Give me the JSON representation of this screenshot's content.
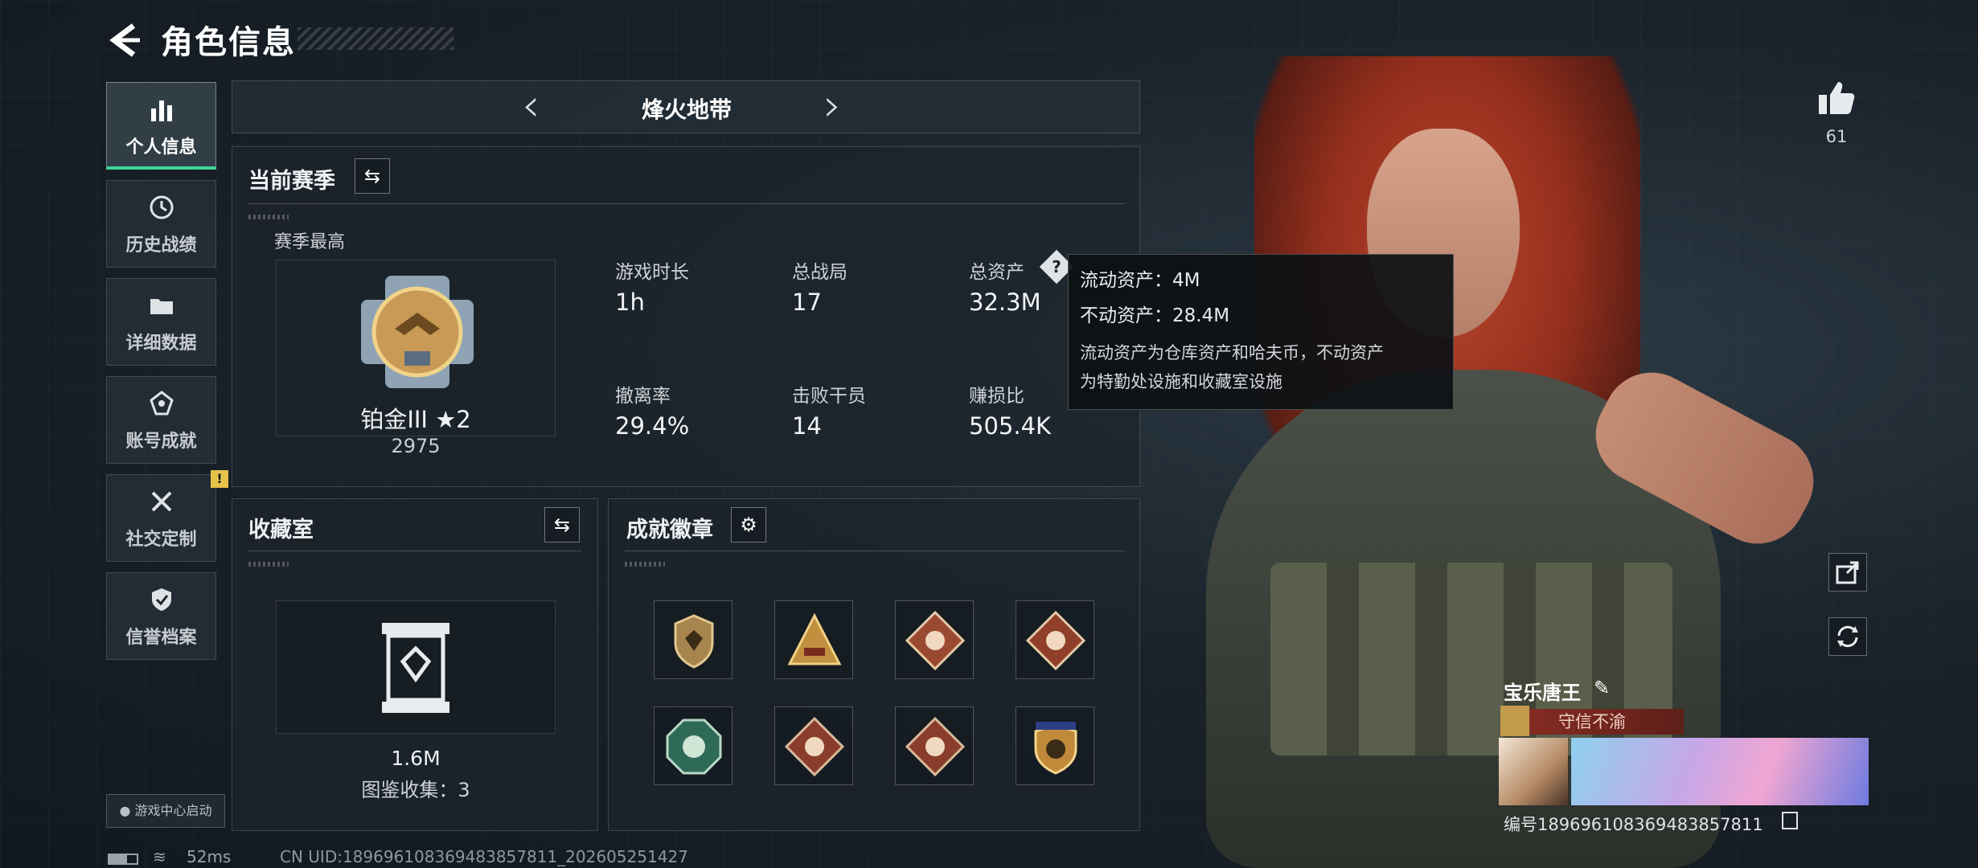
{
  "header": {
    "title": "角色信息"
  },
  "sidebar": {
    "items": [
      {
        "label": "个人信息",
        "active": true
      },
      {
        "label": "历史战绩"
      },
      {
        "label": "详细数据"
      },
      {
        "label": "账号成就"
      },
      {
        "label": "社交定制",
        "badge": "!"
      },
      {
        "label": "信誉档案"
      }
    ],
    "launch": "游戏中心启动"
  },
  "mode_bar": {
    "name": "烽火地带"
  },
  "season": {
    "title": "当前赛季",
    "best_label": "赛季最高",
    "rank_name": "铂金III ★2",
    "rank_score": "2975",
    "stats": [
      {
        "label": "游戏时长",
        "value": "1h"
      },
      {
        "label": "总战局",
        "value": "17"
      },
      {
        "label": "总资产",
        "value": "32.3M"
      },
      {
        "label": "撤离率",
        "value": "29.4%"
      },
      {
        "label": "击败干员",
        "value": "14"
      },
      {
        "label": "赚损比",
        "value": "505.4K"
      }
    ]
  },
  "tooltip": {
    "line1": "流动资产：4M",
    "line2": "不动资产：28.4M",
    "desc_line1": "流动资产为仓库资产和哈夫币，不动资产",
    "desc_line2": "为特勤处设施和收藏室设施"
  },
  "collection": {
    "title": "收藏室",
    "value": "1.6M",
    "count_label": "图鉴收集：3"
  },
  "achievements": {
    "title": "成就徽章"
  },
  "likes": {
    "count": "61"
  },
  "player": {
    "name": "宝乐唐王",
    "motto": "守信不渝",
    "id_line": "编号1896961083694838578​11"
  },
  "footer": {
    "ping": "52ms",
    "uid": "CN UID:1896961083694838578​11_202605251427"
  },
  "colors": {
    "accent": "#3fd49a",
    "warning": "#e6c24a",
    "motto_bg": "#7a2a22"
  }
}
